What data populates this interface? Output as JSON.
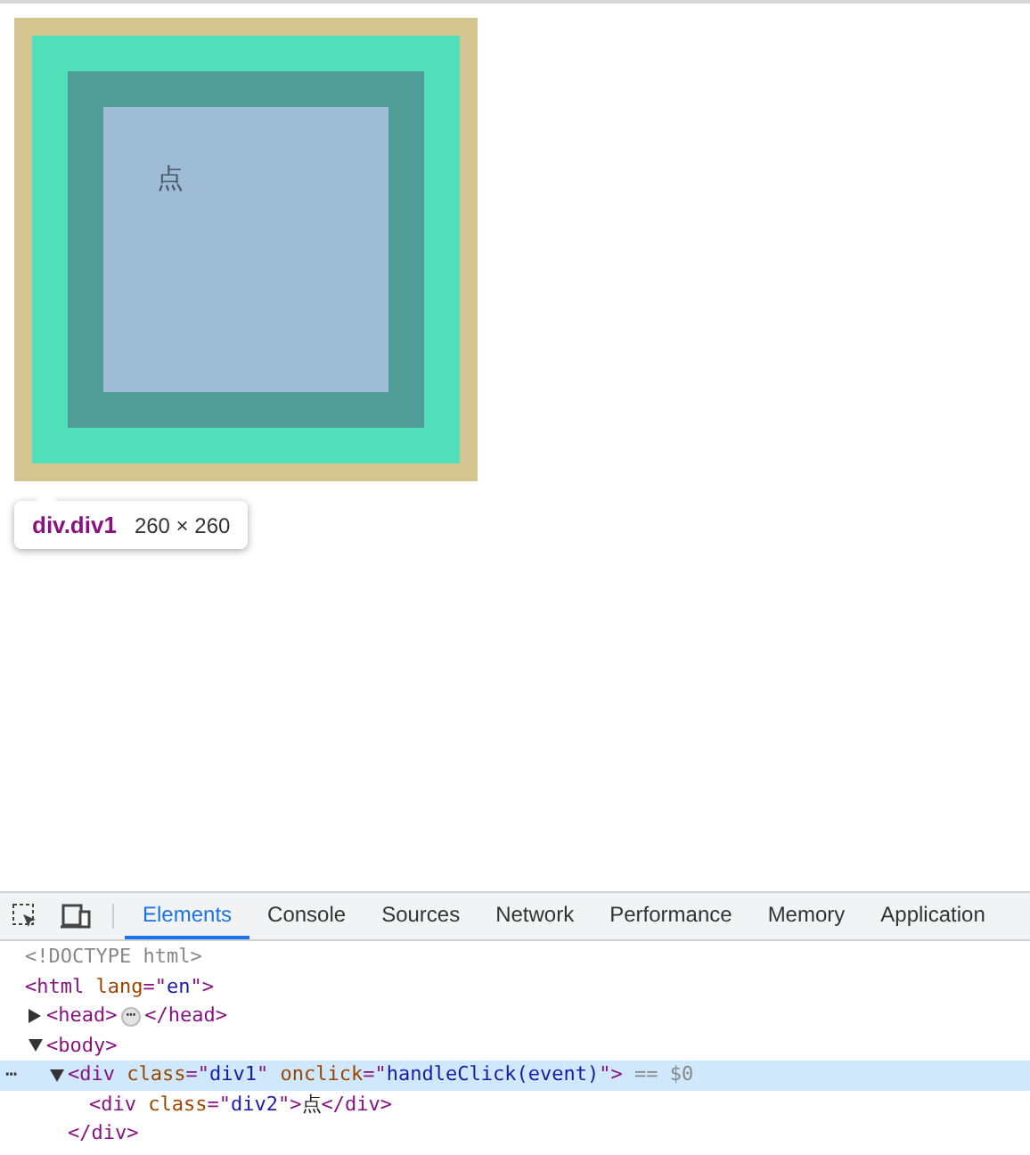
{
  "page": {
    "text": "点"
  },
  "tooltip": {
    "selector": "div.div1",
    "size": "260 × 260"
  },
  "devtools": {
    "tabs": [
      {
        "label": "Elements",
        "selected": true
      },
      {
        "label": "Console",
        "selected": false
      },
      {
        "label": "Sources",
        "selected": false
      },
      {
        "label": "Network",
        "selected": false
      },
      {
        "label": "Performance",
        "selected": false
      },
      {
        "label": "Memory",
        "selected": false
      },
      {
        "label": "Application",
        "selected": false
      }
    ],
    "tree": [
      {
        "selected": false,
        "line": [
          {
            "kind": "muted",
            "text": "<!DOCTYPE html>"
          }
        ]
      },
      {
        "selected": false,
        "line": [
          {
            "kind": "tag",
            "text": "<html "
          },
          {
            "kind": "attr",
            "text": "lang"
          },
          {
            "kind": "tag",
            "text": "=\""
          },
          {
            "kind": "value",
            "text": "en"
          },
          {
            "kind": "tag",
            "text": "\">"
          }
        ],
        "children": [
          {
            "selected": false,
            "expanded": false,
            "line": [
              {
                "kind": "tag",
                "text": "<head>"
              },
              {
                "kind": "badge",
                "text": "⋯"
              },
              {
                "kind": "tag",
                "text": "</head>"
              }
            ]
          },
          {
            "selected": false,
            "expanded": true,
            "line": [
              {
                "kind": "tag",
                "text": "<body>"
              }
            ],
            "children": [
              {
                "selected": true,
                "expanded": true,
                "gutter_mark": "⋯",
                "line": [
                  {
                    "kind": "tag",
                    "text": "<div "
                  },
                  {
                    "kind": "attr",
                    "text": "class"
                  },
                  {
                    "kind": "tag",
                    "text": "=\""
                  },
                  {
                    "kind": "value",
                    "text": "div1"
                  },
                  {
                    "kind": "tag",
                    "text": "\" "
                  },
                  {
                    "kind": "attr",
                    "text": "onclick"
                  },
                  {
                    "kind": "tag",
                    "text": "=\""
                  },
                  {
                    "kind": "value",
                    "text": "handleClick(event)"
                  },
                  {
                    "kind": "tag",
                    "text": "\">"
                  },
                  {
                    "kind": "muted",
                    "text": " == $0"
                  }
                ],
                "children": [
                  {
                    "selected": false,
                    "line": [
                      {
                        "kind": "tag",
                        "text": "<div "
                      },
                      {
                        "kind": "attr",
                        "text": "class"
                      },
                      {
                        "kind": "tag",
                        "text": "=\""
                      },
                      {
                        "kind": "value",
                        "text": "div2"
                      },
                      {
                        "kind": "tag",
                        "text": "\">"
                      },
                      {
                        "kind": "text",
                        "text": "点"
                      },
                      {
                        "kind": "tag",
                        "text": "</div>"
                      }
                    ]
                  }
                ],
                "close": [
                  {
                    "kind": "tag",
                    "text": "</div>"
                  }
                ]
              }
            ]
          }
        ]
      }
    ]
  }
}
